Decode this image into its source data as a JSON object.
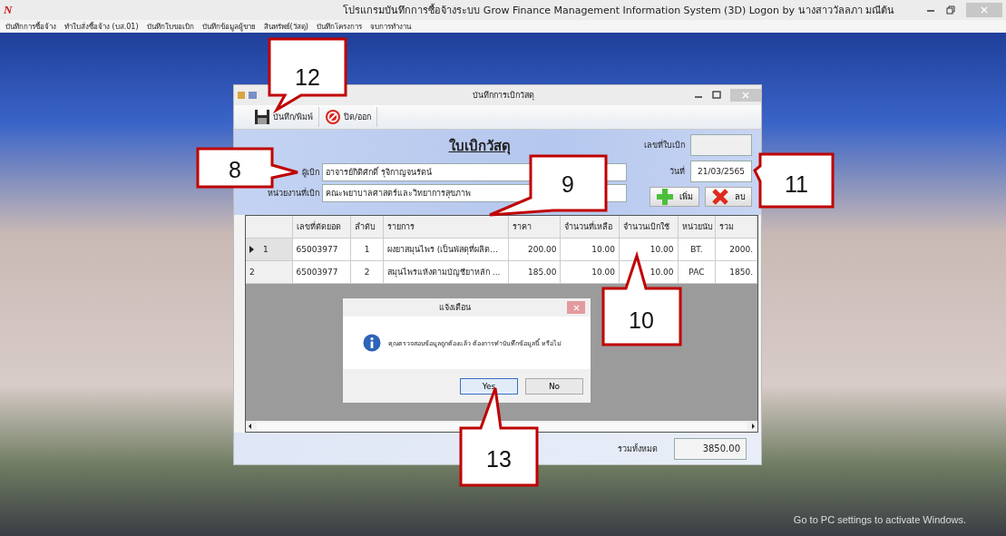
{
  "window": {
    "logo": "N",
    "title": "โปรแกรมบันทึกการซื้อจ้างระบบ  Grow Finance Management Information System (3D) Logon by นางสาววัลลภา  มณีต้น"
  },
  "menu": [
    "บันทึกการซื้อจ้าง",
    "ทำใบสั่งซื้อจ้าง (บส.01)",
    "บันทึกใบขอเบิก",
    "บันทึกข้อมูลผู้ขาย",
    "สินทรัพย์(วัสดุ)",
    "บันทึกโครงการ",
    "จบการทำงาน"
  ],
  "form_window": {
    "title": "บันทึกการเบิกวัสดุ",
    "toolbar": [
      {
        "label": "บันทึก/พิมพ์",
        "kind": "save"
      },
      {
        "label": "ปิด/ออก",
        "kind": "close"
      }
    ],
    "heading": "ใบเบิกวัสดุ",
    "requester": {
      "label": "ผู้เบิก",
      "value": "อาจารย์กิติศักดิ์  รุจิกาญจนรัตน์"
    },
    "department": {
      "label": "หน่วยงานที่เบิก",
      "value": "คณะพยาบาลศาสตร์และวิทยาการสุขภาพ"
    },
    "slip_number": {
      "label": "เลขที่ใบเบิก"
    },
    "date": {
      "label": "วันที่",
      "value": "21/03/2565"
    },
    "actions": [
      {
        "label": "เพิ่ม",
        "kind": "add"
      },
      {
        "label": "ลบ",
        "kind": "delete"
      }
    ],
    "table": {
      "columns": [
        "เลขที่ตัดยอด",
        "ลำดับ",
        "รายการ",
        "ราคา",
        "จำนวนที่เหลือ",
        "จำนวนเบิกใช้",
        "หน่วยนับ",
        "รวม"
      ],
      "rows": [
        {
          "current": true,
          "number": "1",
          "cells": [
            "65003977",
            "1",
            "ผงยาสมุนไพร (เป็นพัสดุที่ผลิต...",
            "200.00",
            "10.00",
            "10.00",
            "BT.",
            "2000."
          ]
        },
        {
          "current": false,
          "number": "2",
          "cells": [
            "65003977",
            "2",
            "สมุนไพรแห้งตามบัญชียาหลัก ...",
            "185.00",
            "10.00",
            "10.00",
            "PAC",
            "1850."
          ]
        }
      ]
    },
    "total": {
      "label": "รวมทั้งหมด",
      "value": "3850.00"
    }
  },
  "dialog": {
    "title": "แจ้งเตือน",
    "message": "คุณตรวจสอบข้อมูลถูกต้องแล้ว ต้องการทำบันทึกข้อมูลนี้ หรือไม่",
    "buttons": [
      {
        "label": "Yes",
        "selected": true
      },
      {
        "label": "No",
        "selected": false
      }
    ]
  },
  "callouts": [
    "12",
    "8",
    "9",
    "10",
    "11",
    "13"
  ],
  "activation_notice": "Go to PC settings to activate Windows."
}
